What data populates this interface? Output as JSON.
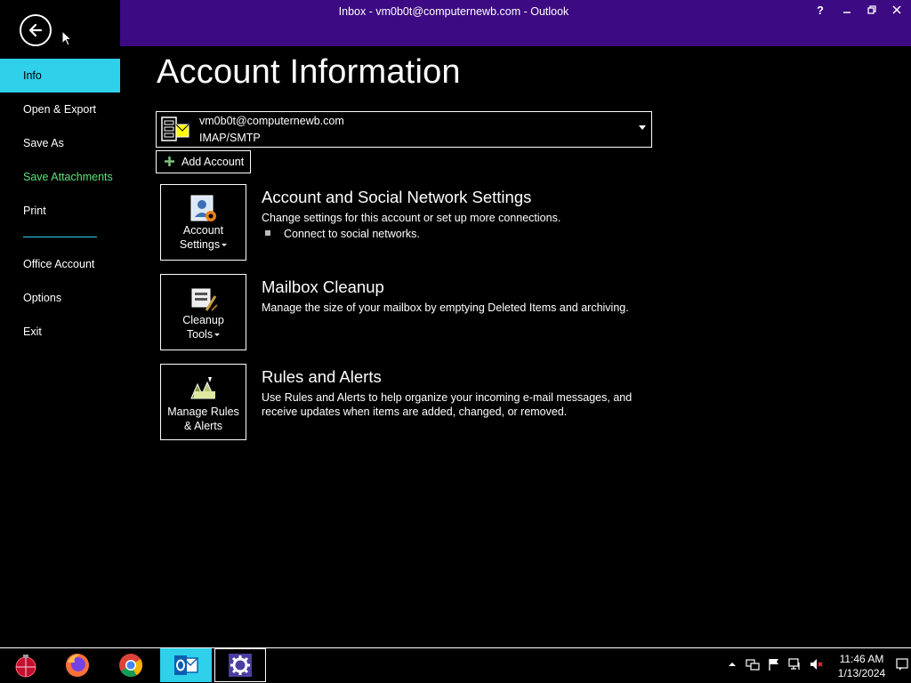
{
  "window": {
    "title": "Inbox - vm0b0t@computernewb.com - Outlook",
    "help_label": "?"
  },
  "sidebar": {
    "items": [
      {
        "label": "Info"
      },
      {
        "label": "Open & Export"
      },
      {
        "label": "Save As"
      },
      {
        "label": "Save Attachments"
      },
      {
        "label": "Print"
      },
      {
        "label": "Office Account"
      },
      {
        "label": "Options"
      },
      {
        "label": "Exit"
      }
    ]
  },
  "main": {
    "title": "Account Information",
    "account": {
      "email": "vm0b0t@computernewb.com",
      "type": "IMAP/SMTP"
    },
    "add_account_label": "Add Account",
    "sections": [
      {
        "tile_line1": "Account",
        "tile_line2": "Settings",
        "title": "Account and Social Network Settings",
        "description": "Change settings for this account or set up more connections.",
        "bullet": "Connect to social networks."
      },
      {
        "tile_line1": "Cleanup",
        "tile_line2": "Tools",
        "title": "Mailbox Cleanup",
        "description": "Manage the size of your mailbox by emptying Deleted Items and archiving."
      },
      {
        "tile_line1": "Manage Rules",
        "tile_line2": "& Alerts",
        "title": "Rules and Alerts",
        "description": "Use Rules and Alerts to help organize your incoming e-mail messages, and receive updates when items are added, changed, or removed."
      }
    ]
  },
  "taskbar": {
    "time": "11:46 AM",
    "date": "1/13/2024",
    "apps": [
      "start-orb-icon",
      "firefox-icon",
      "chrome-icon",
      "outlook-icon",
      "settings-icon"
    ]
  },
  "colors": {
    "accent": "#2fd0ea",
    "titlebar": "#3c0a82",
    "highlight_green": "#5fe07a"
  }
}
